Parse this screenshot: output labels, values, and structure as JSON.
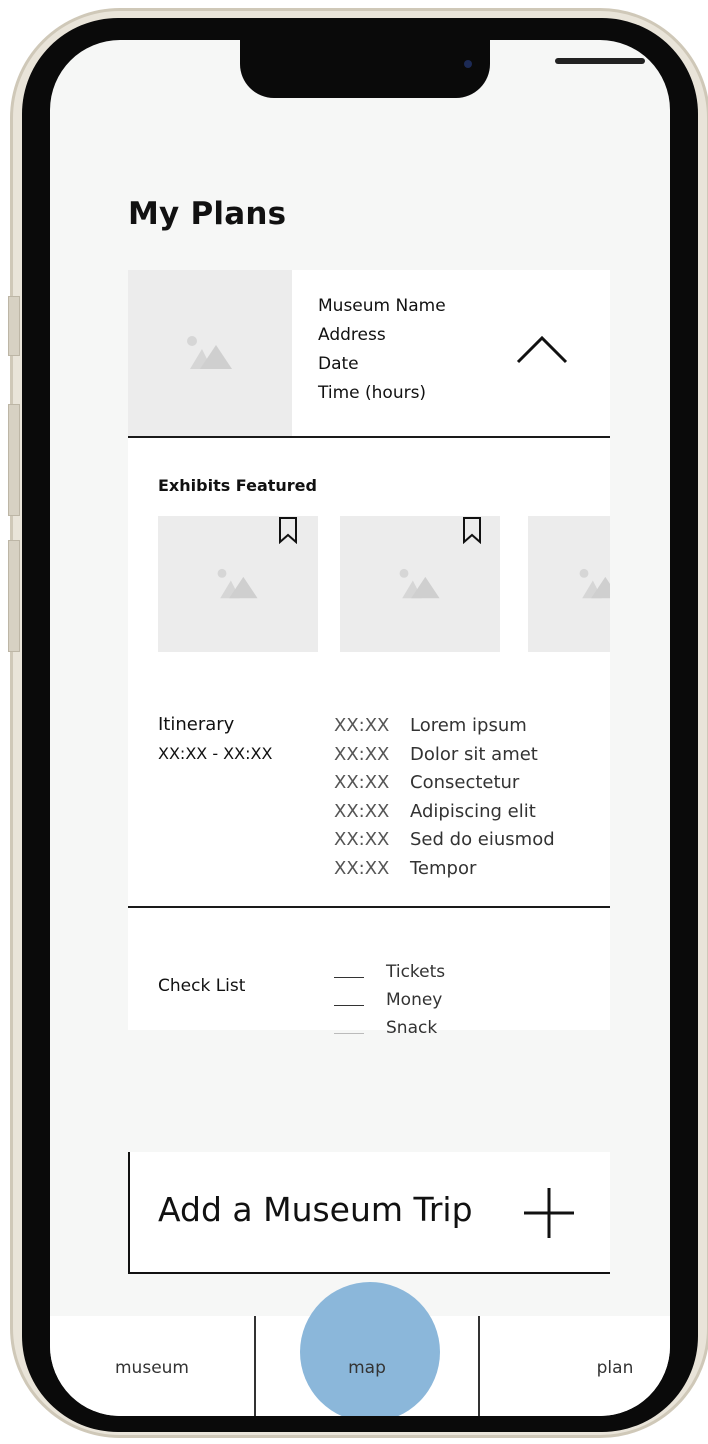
{
  "page": {
    "title": "My Plans"
  },
  "plan_card": {
    "museum_info": [
      "Museum Name",
      "Address",
      "Date",
      "Time (hours)"
    ],
    "collapse_icon": "chevron-up-icon",
    "exhibits_title": "Exhibits Featured",
    "itinerary": {
      "title": "Itinerary",
      "time_range": "XX:XX - XX:XX",
      "items": [
        {
          "time": "XX:XX",
          "text": "Lorem ipsum"
        },
        {
          "time": "XX:XX",
          "text": "Dolor sit amet"
        },
        {
          "time": "XX:XX",
          "text": "Consectetur"
        },
        {
          "time": "XX:XX",
          "text": "Adipiscing elit"
        },
        {
          "time": "XX:XX",
          "text": "Sed do eiusmod"
        },
        {
          "time": "XX:XX",
          "text": "Tempor"
        }
      ]
    },
    "checklist": {
      "title": "Check List",
      "items": [
        "Tickets",
        "Money",
        "Snack"
      ]
    }
  },
  "add_trip": {
    "label": "Add a Museum Trip",
    "icon": "plus-icon"
  },
  "tabs": [
    {
      "label": "museum"
    },
    {
      "label": "map"
    },
    {
      "label": "plan"
    }
  ],
  "colors": {
    "map_highlight": "#8bb7da",
    "placeholder": "#ececec",
    "screen_bg": "#f6f7f6"
  }
}
